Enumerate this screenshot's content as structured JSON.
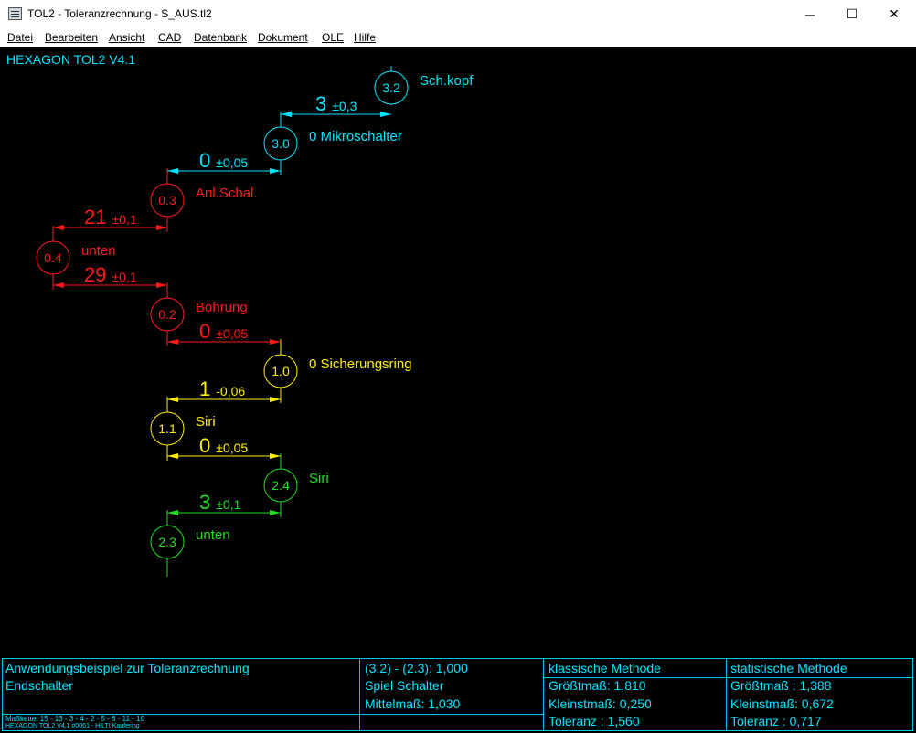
{
  "window": {
    "title": "TOL2 - Toleranzrechnung  -  S_AUS.tl2",
    "minimize": "─",
    "maximize": "☐",
    "close": "✕"
  },
  "menu": [
    {
      "label": "Datei"
    },
    {
      "label": "Bearbeiten"
    },
    {
      "label": "Ansicht"
    },
    {
      "label": "CAD"
    },
    {
      "label": "Datenbank"
    },
    {
      "label": "Dokument"
    },
    {
      "label": "OLE"
    },
    {
      "label": "Hilfe"
    }
  ],
  "colors": {
    "cyan": "#00e5ff",
    "red": "#ff1a1a",
    "yellow": "#ffee00",
    "green": "#22dd22",
    "background": "#000000"
  },
  "brand": "HEXAGON TOL2 V4.1",
  "nodes": [
    {
      "id": "3.2",
      "label": "Sch.kopf",
      "color": "cyan"
    },
    {
      "id": "3.0",
      "label": "0 Mikroschalter",
      "color": "cyan"
    },
    {
      "id": "0.3",
      "label": "Anl.Schal.",
      "color": "red"
    },
    {
      "id": "0.4",
      "label": "unten",
      "color": "red"
    },
    {
      "id": "0.2",
      "label": "Bohrung",
      "color": "red"
    },
    {
      "id": "1.0",
      "label": "0 Sicherungsring",
      "color": "yellow"
    },
    {
      "id": "1.1",
      "label": "Siri",
      "color": "yellow"
    },
    {
      "id": "2.4",
      "label": "Siri",
      "color": "green"
    },
    {
      "id": "2.3",
      "label": "unten",
      "color": "green"
    }
  ],
  "dimensions": [
    {
      "value": "3",
      "tol": "±0,3",
      "color": "cyan"
    },
    {
      "value": "0",
      "tol": "±0,05",
      "color": "cyan"
    },
    {
      "value": "21",
      "tol": "±0,1",
      "color": "red"
    },
    {
      "value": "29",
      "tol": "±0,1",
      "color": "red"
    },
    {
      "value": "0",
      "tol": "±0,05",
      "color": "red"
    },
    {
      "value": "1",
      "tol": "-0,06",
      "color": "yellow"
    },
    {
      "value": "0",
      "tol": "±0,05",
      "color": "yellow"
    },
    {
      "value": "3",
      "tol": "±0,1",
      "color": "green"
    }
  ],
  "footer": {
    "desc1": "Anwendungsbeispiel zur Toleranzrechnung",
    "desc2": "Endschalter",
    "chain": "Maßkette: 15 - 13 - 3 - 4 - 2 - 5 - 6 - 11 - 10",
    "license": "HEXAGON TOL2 V4.1 #0061 - HILTI  Kaufering",
    "result": "(3.2) - (2.3): 1,000",
    "name": "Spiel Schalter",
    "mittelmass": "Mittelmaß: 1,030",
    "classic": {
      "title": "klassische Methode",
      "max": "Größtmaß: 1,810",
      "min": "Kleinstmaß: 0,250",
      "tol": "Toleranz : 1,560"
    },
    "statistic": {
      "title": "statistische Methode",
      "max": "Größtmaß : 1,388",
      "min": "Kleinstmaß: 0,672",
      "tol": "Toleranz : 0,717"
    }
  }
}
